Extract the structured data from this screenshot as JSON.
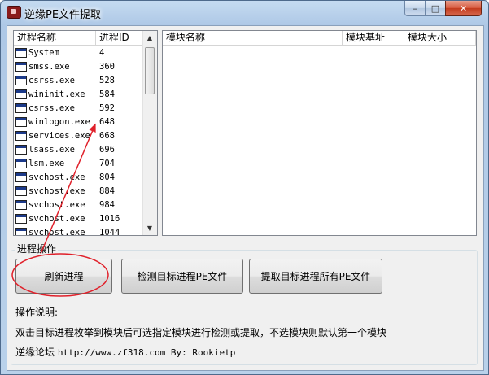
{
  "window": {
    "title": "逆缘PE文件提取",
    "controls": {
      "minimize": "–",
      "maximize": "□",
      "close": "✕"
    }
  },
  "process_list": {
    "columns": [
      "进程名称",
      "进程ID"
    ],
    "rows": [
      {
        "name": "System",
        "pid": "4"
      },
      {
        "name": "smss.exe",
        "pid": "360"
      },
      {
        "name": "csrss.exe",
        "pid": "528"
      },
      {
        "name": "wininit.exe",
        "pid": "584"
      },
      {
        "name": "csrss.exe",
        "pid": "592"
      },
      {
        "name": "winlogon.exe",
        "pid": "648"
      },
      {
        "name": "services.exe",
        "pid": "668"
      },
      {
        "name": "lsass.exe",
        "pid": "696"
      },
      {
        "name": "lsm.exe",
        "pid": "704"
      },
      {
        "name": "svchost.exe",
        "pid": "804"
      },
      {
        "name": "svchost.exe",
        "pid": "884"
      },
      {
        "name": "svchost.exe",
        "pid": "984"
      },
      {
        "name": "svchost.exe",
        "pid": "1016"
      },
      {
        "name": "svchost.exe",
        "pid": "1044"
      }
    ],
    "scroll_up": "▲",
    "scroll_down": "▼"
  },
  "module_list": {
    "columns": [
      "模块名称",
      "模块基址",
      "模块大小"
    ]
  },
  "operations": {
    "group_title": "进程操作",
    "refresh_label": "刷新进程",
    "detect_label": "检测目标进程PE文件",
    "extract_label": "提取目标进程所有PE文件"
  },
  "help": {
    "heading": "操作说明:",
    "description": "双击目标进程枚举到模块后可选指定模块进行检测或提取，不选模块则默认第一个模块",
    "forum_label": "逆缘论坛",
    "forum_info": "http://www.zf318.com By: Rookietp"
  },
  "colors": {
    "annotation": "#e0202a",
    "close_button": "#c8452a"
  }
}
